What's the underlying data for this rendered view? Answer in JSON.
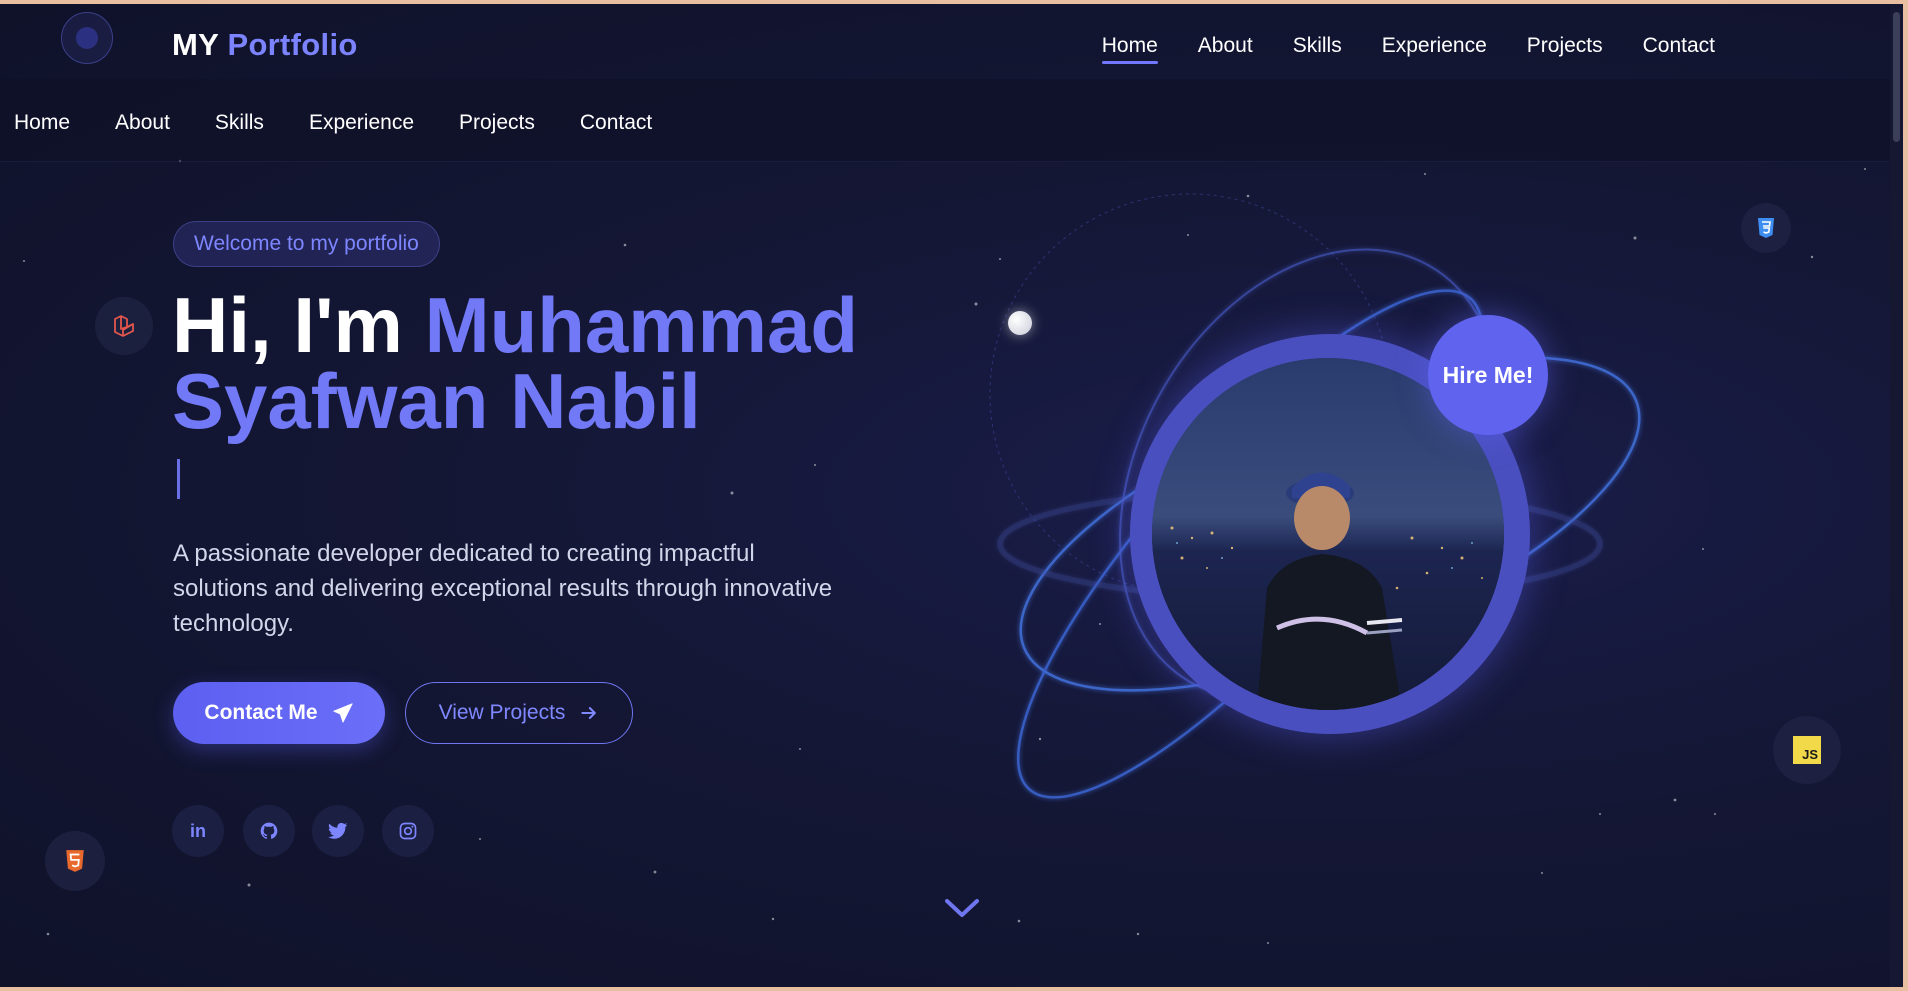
{
  "header": {
    "brand_prefix": "MY",
    "brand_accent": "Portfolio",
    "nav": [
      "Home",
      "About",
      "Skills",
      "Experience",
      "Projects",
      "Contact"
    ],
    "active": "Home"
  },
  "subnav": [
    "Home",
    "About",
    "Skills",
    "Experience",
    "Projects",
    "Contact"
  ],
  "hero": {
    "badge": "Welcome to my portfolio",
    "greeting": "Hi, I'm",
    "name_line1": "Muhammad",
    "name_line2": "Syafwan Nabil",
    "description": "A passionate developer dedicated to creating impactful solutions and delivering exceptional results through innovative technology.",
    "primary_button": "Contact Me",
    "secondary_button": "View Projects",
    "hire_badge": "Hire Me!"
  },
  "social": {
    "linkedin": "in"
  },
  "tech_badges": {
    "js": "JS"
  },
  "colors": {
    "accent": "#7179f7",
    "background": "#141735",
    "button": "#5f63ee"
  },
  "icons": [
    "laravel-icon",
    "css3-icon",
    "javascript-icon",
    "html5-icon",
    "linkedin-icon",
    "github-icon",
    "twitter-icon",
    "instagram-icon",
    "send-icon",
    "arrow-right-icon",
    "chevron-down-icon"
  ]
}
